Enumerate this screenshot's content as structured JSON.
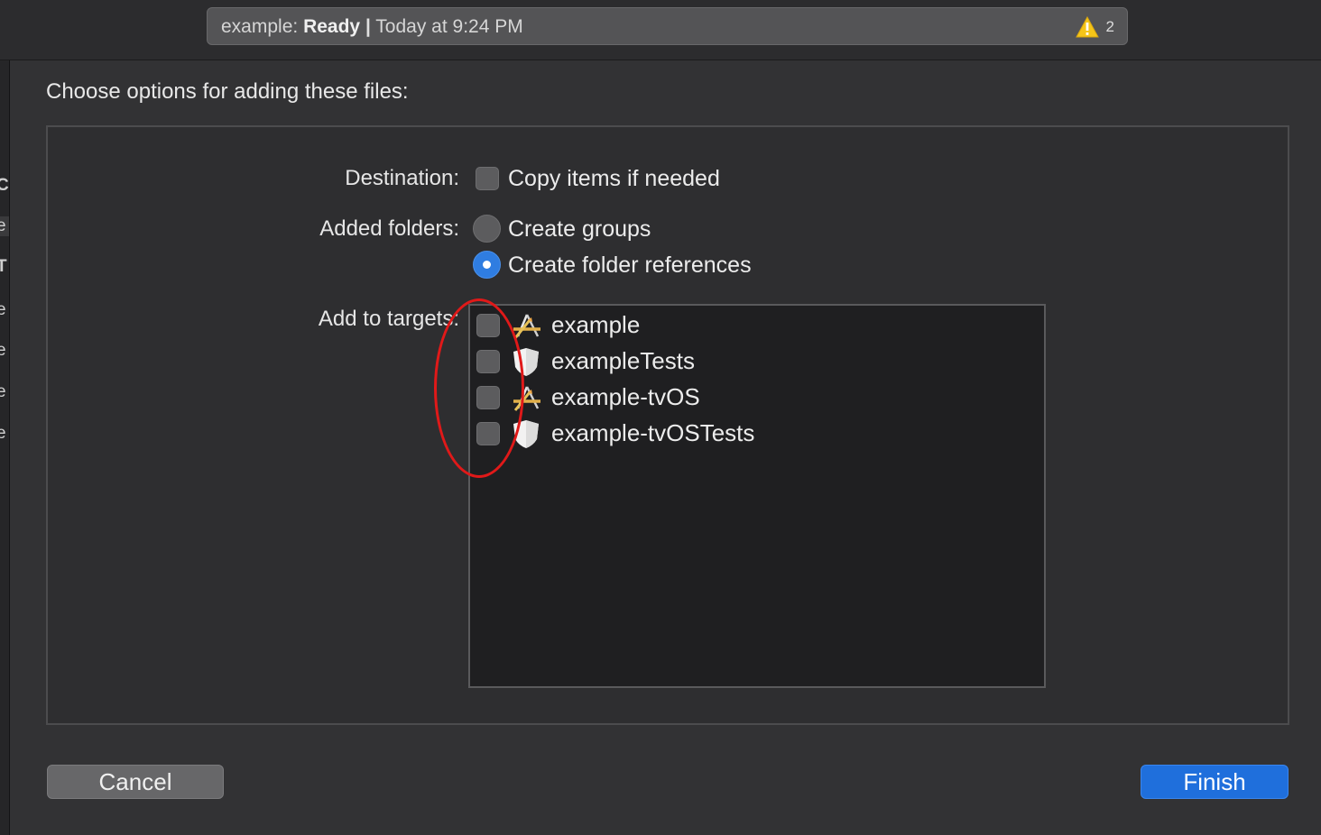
{
  "toolbar": {
    "project": "example:",
    "status": "Ready",
    "separator": "|",
    "time": "Today at 9:24 PM",
    "warning_count": "2",
    "warning_icon": "warning-triangle-icon"
  },
  "sidebar_fragments": [
    "C",
    "e",
    "T",
    "e",
    "e",
    "e",
    "e"
  ],
  "dialog": {
    "heading": "Choose options for adding these files:",
    "destination_label": "Destination:",
    "copy_items_label": "Copy items if needed",
    "copy_items_checked": false,
    "added_folders_label": "Added folders:",
    "folder_options": [
      {
        "label": "Create groups",
        "selected": false
      },
      {
        "label": "Create folder references",
        "selected": true
      }
    ],
    "targets_label": "Add to targets:",
    "targets": [
      {
        "name": "example",
        "icon": "app-icon",
        "checked": false
      },
      {
        "name": "exampleTests",
        "icon": "test-shield-icon",
        "checked": false
      },
      {
        "name": "example-tvOS",
        "icon": "app-icon",
        "checked": false
      },
      {
        "name": "example-tvOSTests",
        "icon": "test-shield-icon",
        "checked": false
      }
    ],
    "cancel_label": "Cancel",
    "finish_label": "Finish"
  },
  "colors": {
    "accent": "#2f7de1",
    "annotation": "#e01919"
  }
}
